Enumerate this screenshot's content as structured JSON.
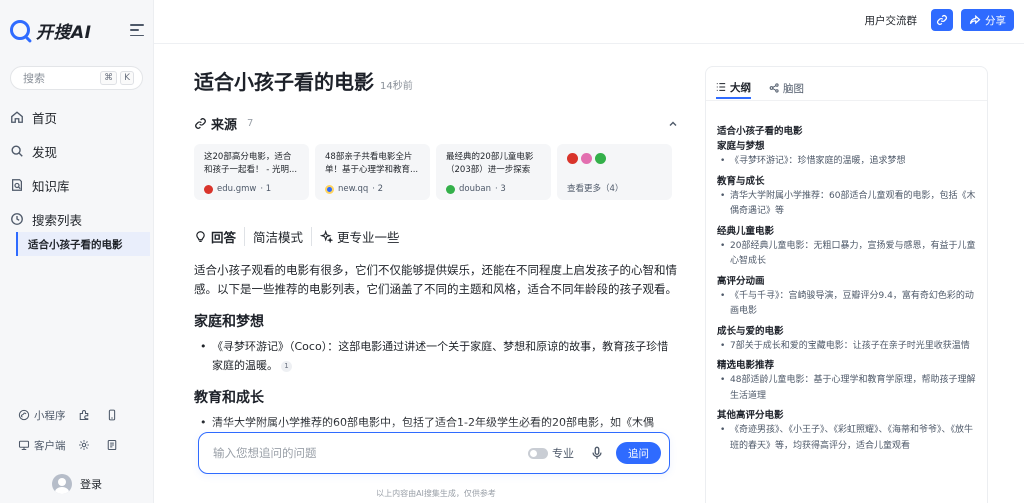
{
  "brand": {
    "name": "开搜AI",
    "accent": "#2f6bff"
  },
  "sidebar": {
    "search_placeholder": "搜索",
    "search_keys": [
      "⌘",
      "K"
    ],
    "nav": [
      {
        "label": "首页",
        "icon": "home-icon"
      },
      {
        "label": "发现",
        "icon": "search-icon"
      },
      {
        "label": "知识库",
        "icon": "knowledge-icon"
      },
      {
        "label": "搜索列表",
        "icon": "history-icon"
      }
    ],
    "history": [
      {
        "label": "适合小孩子看的电影"
      }
    ],
    "bottom": {
      "mini_program": "小程序",
      "client": "客户端",
      "login": "登录"
    }
  },
  "topbar": {
    "community": "用户交流群",
    "share": "分享"
  },
  "main": {
    "title": "适合小孩子看的电影",
    "time": "14秒前",
    "sources": {
      "label": "来源",
      "count": "7",
      "cards": [
        {
          "title": "这20部高分电影，适合和孩子一起看！ - 光明...",
          "site": "edu.gmw",
          "index": "· 1"
        },
        {
          "title": "48部亲子共看电影全片单！基于心理学和教育...",
          "site": "new.qq",
          "index": "· 2"
        },
        {
          "title": "最经典的20部儿童电影（203部）进一步探索",
          "site": "douban",
          "index": "· 3"
        }
      ],
      "more": "查看更多（4）"
    },
    "answer_tabs": [
      "回答",
      "简洁模式",
      "更专业一些"
    ],
    "intro": "适合小孩子观看的电影有很多，它们不仅能够提供娱乐，还能在不同程度上启发孩子的心智和情感。以下是一些推荐的电影列表，它们涵盖了不同的主题和风格，适合不同年龄段的孩子观看。",
    "sections": [
      {
        "heading": "家庭和梦想",
        "bullet": "《寻梦环游记》（Coco）：这部电影通过讲述一个关于家庭、梦想和原谅的故事，教育孩子珍惜家庭的温暖。",
        "cite": "1"
      },
      {
        "heading": "教育和成长",
        "bullet": "清华大学附属小学推荐的60部电影中，包括了适合1-2年级学生必看的20部电影，如《木偶"
      }
    ],
    "ask": {
      "placeholder": "输入您想追问的问题",
      "pro": "专业",
      "button": "追问"
    },
    "disclaimer": "以上内容由AI搜集生成，仅供参考"
  },
  "outline": {
    "tabs": [
      "大纲",
      "脑图"
    ],
    "title": "适合小孩子看的电影",
    "sections": [
      {
        "heading": "家庭与梦想",
        "items": [
          "《寻梦环游记》：珍惜家庭的温暖，追求梦想"
        ]
      },
      {
        "heading": "教育与成长",
        "items": [
          "清华大学附属小学推荐：60部适合儿童观看的电影，包括《木偶奇遇记》等"
        ]
      },
      {
        "heading": "经典儿童电影",
        "items": [
          "20部经典儿童电影：无粗口暴力，宣扬爱与感恩，有益于儿童心智成长"
        ]
      },
      {
        "heading": "高评分动画",
        "items": [
          "《千与千寻》：宫崎骏导演，豆瓣评分9.4，富有奇幻色彩的动画电影"
        ]
      },
      {
        "heading": "成长与爱的电影",
        "items": [
          "7部关于成长和爱的宝藏电影：让孩子在亲子时光里收获温情"
        ]
      },
      {
        "heading": "精选电影推荐",
        "items": [
          "48部适龄儿童电影：基于心理学和教育学原理，帮助孩子理解生活道理"
        ]
      },
      {
        "heading": "其他高评分电影",
        "items": [
          "《奇迹男孩》、《小王子》、《彩虹照耀》、《海蒂和爷爷》、《放牛班的春天》等，均获得高评分，适合儿童观看"
        ]
      }
    ]
  }
}
